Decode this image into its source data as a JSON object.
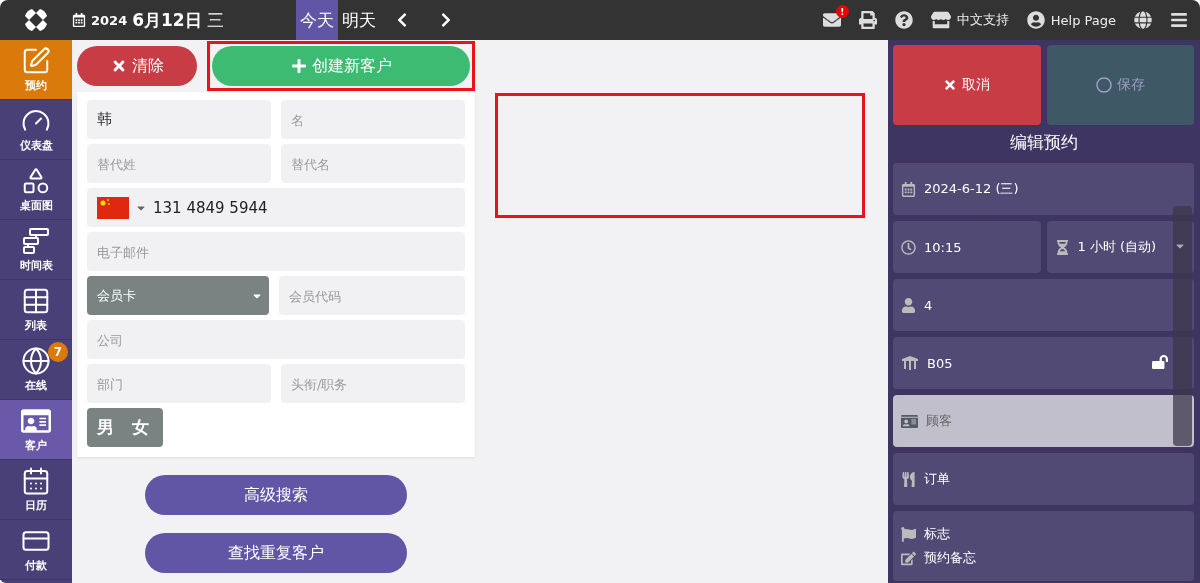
{
  "topbar": {
    "date_year": "2024",
    "date_day": "6月12日",
    "date_weekday": "三",
    "day_tabs": [
      {
        "label": "今天",
        "selected": true
      },
      {
        "label": "明天",
        "selected": false
      }
    ],
    "mail_alert": "!",
    "support": "中文支持",
    "help": "Help Page"
  },
  "sidebar": {
    "items": [
      {
        "label": "预约",
        "kind": "action",
        "selected": false
      },
      {
        "label": "仪表盘",
        "kind": "nav",
        "selected": false
      },
      {
        "label": "桌面图",
        "kind": "nav",
        "selected": false
      },
      {
        "label": "时间表",
        "kind": "nav",
        "selected": false
      },
      {
        "label": "列表",
        "kind": "nav",
        "selected": false
      },
      {
        "label": "在线",
        "kind": "nav",
        "selected": false,
        "badge": "7"
      },
      {
        "label": "客户",
        "kind": "nav",
        "selected": true
      },
      {
        "label": "日历",
        "kind": "nav",
        "selected": false
      },
      {
        "label": "付款",
        "kind": "nav",
        "selected": false
      }
    ]
  },
  "clear_button": "清除",
  "create_button": {
    "label": "创建新客户",
    "highlighted": true
  },
  "main_area": {
    "highlight_frame": true
  },
  "form": {
    "rows": [
      [
        {
          "value": "韩"
        },
        {
          "placeholder": "名"
        }
      ],
      [
        {
          "placeholder": "替代姓"
        },
        {
          "placeholder": "替代名"
        }
      ],
      [
        {
          "kind": "phone",
          "value": "131 4849 5944"
        }
      ],
      [
        {
          "placeholder": "电子邮件"
        }
      ],
      [
        {
          "kind": "select",
          "value": "会员卡"
        },
        {
          "placeholder": "会员代码"
        }
      ],
      [
        {
          "placeholder": "公司"
        }
      ],
      [
        {
          "placeholder": "部门"
        },
        {
          "placeholder": "头衔/职务"
        }
      ]
    ],
    "gender": [
      "男",
      "女"
    ]
  },
  "bottom_buttons": [
    "高级搜索",
    "查找重复客户"
  ],
  "panel": {
    "cancel": "取消",
    "save": {
      "label": "保存",
      "disabled": true
    },
    "title": "编辑预约",
    "rows": [
      [
        {
          "kind": "date",
          "text": "2024-6-12 (三)",
          "selected": false
        }
      ],
      [
        {
          "kind": "time",
          "text": "10:15",
          "selected": false
        },
        {
          "kind": "duration",
          "text": "1 小时 (自动)",
          "selected": false,
          "dropdown": true
        }
      ],
      [
        {
          "kind": "guests",
          "text": "4",
          "selected": false
        }
      ],
      [
        {
          "kind": "table",
          "text": "B05",
          "selected": false,
          "unlocked": true
        }
      ],
      [
        {
          "kind": "customer",
          "text": "顾客",
          "selected": true
        }
      ],
      [
        {
          "kind": "order",
          "text": "订单",
          "selected": false
        }
      ],
      [
        {
          "kind": "flags",
          "text": "标志",
          "selected": false,
          "note": "预约备忘"
        }
      ]
    ]
  }
}
